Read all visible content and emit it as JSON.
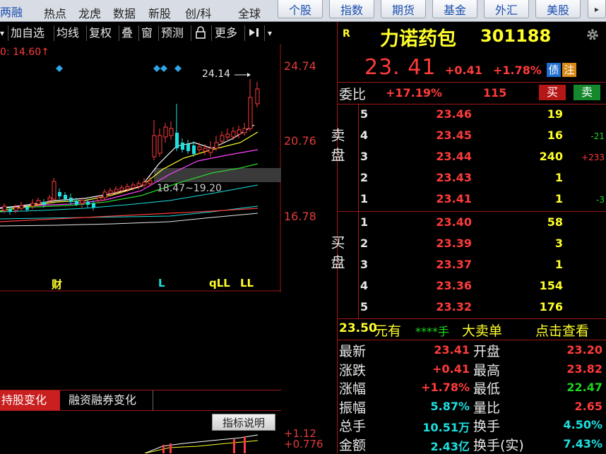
{
  "topnav": {
    "items": [
      "两融",
      "热点",
      "龙虎",
      "数据",
      "新股",
      "创/科",
      "全球"
    ],
    "buttons": [
      "个股",
      "指数",
      "期货",
      "基金",
      "外汇",
      "美股"
    ]
  },
  "toolbar": {
    "items": [
      "加自选",
      "均线",
      "复权",
      "叠",
      "窗",
      "预测",
      "更多"
    ],
    "lock_icon": "lock-icon",
    "expand_icon": "expand-arrow-icon",
    "dropdown_icon": "chevron-down-icon"
  },
  "chart": {
    "ma_label": "0: 14.60↑",
    "price_axis": [
      "24.74",
      "20.76",
      "16.78"
    ],
    "high_marker": "24.14",
    "range_label": "18.47~19.20",
    "event_markers": [
      "财",
      "L",
      "qLL",
      "LL"
    ],
    "colors": {
      "up": "#ff3b3b",
      "down": "#1ee0e0",
      "ma5": "#ffffff",
      "ma10": "#ffff2b",
      "ma20": "#ff44ff",
      "ma30": "#2bd62b",
      "ma60": "#1ee0e0"
    }
  },
  "bottom_tabs": [
    "持股变化",
    "融资融券变化"
  ],
  "indicator_btn": "指标说明",
  "sub_axis": [
    "+1.12",
    "+0.776"
  ],
  "quote": {
    "badge": "R",
    "name": "力诺药包",
    "code": "301188",
    "price": "23. 41",
    "change": "+0.41",
    "change_pct": "+1.78%",
    "tag_bond": "债",
    "tag_note": "注",
    "settings_icon": "gear-icon"
  },
  "weibi": {
    "label": "委比",
    "pct": "+17.19%",
    "diff": "115",
    "buy": "买",
    "sell": "卖"
  },
  "order_book": {
    "sell_label": "卖盘",
    "buy_label": "买盘",
    "sells": [
      {
        "level": "5",
        "price": "23.46",
        "volume": "19",
        "change": ""
      },
      {
        "level": "4",
        "price": "23.45",
        "volume": "16",
        "change": "-21"
      },
      {
        "level": "3",
        "price": "23.44",
        "volume": "240",
        "change": "+233"
      },
      {
        "level": "2",
        "price": "23.43",
        "volume": "1",
        "change": ""
      },
      {
        "level": "1",
        "price": "23.41",
        "volume": "1",
        "change": "-3"
      }
    ],
    "buys": [
      {
        "level": "1",
        "price": "23.40",
        "volume": "58"
      },
      {
        "level": "2",
        "price": "23.39",
        "volume": "3"
      },
      {
        "level": "3",
        "price": "23.37",
        "volume": "1"
      },
      {
        "level": "4",
        "price": "23.36",
        "volume": "154"
      },
      {
        "level": "5",
        "price": "23.32",
        "volume": "176"
      }
    ]
  },
  "big_order": {
    "price": "23.50",
    "unit": "元有",
    "stars": "****手",
    "label": "大卖单",
    "link": "点击查看"
  },
  "stats": [
    {
      "label": "最新",
      "value": "23.41",
      "color": "#ff3b3b",
      "label2": "开盘",
      "value2": "23.20",
      "color2": "#ff3b3b"
    },
    {
      "label": "涨跌",
      "value": "+0.41",
      "color": "#ff3b3b",
      "label2": "最高",
      "value2": "23.82",
      "color2": "#ff3b3b"
    },
    {
      "label": "涨幅",
      "value": "+1.78%",
      "color": "#ff3b3b",
      "label2": "最低",
      "value2": "22.47",
      "color2": "#1ed51e"
    },
    {
      "label": "振幅",
      "value": "5.87%",
      "color": "#1ee0e0",
      "label2": "量比",
      "value2": "2.65",
      "color2": "#ff3b3b"
    },
    {
      "label": "总手",
      "value": "10.51万",
      "color": "#1ee0e0",
      "label2": "换手",
      "value2": "4.50%",
      "color2": "#1ee0e0"
    },
    {
      "label": "金额",
      "value": "2.43亿",
      "color": "#1ee0e0",
      "label2": "换手(实)",
      "value2": "7.43%",
      "color2": "#1ee0e0"
    }
  ]
}
